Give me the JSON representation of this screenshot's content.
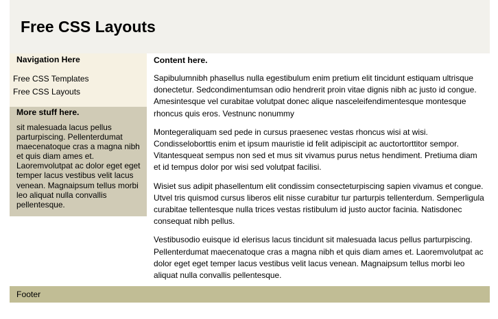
{
  "header": {
    "title": "Free CSS Layouts"
  },
  "content": {
    "title": "Content here.",
    "paragraphs": [
      "Sapibulumnibh phasellus nulla egestibulum enim pretium elit tincidunt estiquam ultrisque donectetur. Sedcondimentumsan odio hendrerit proin vitae dignis nibh ac justo id congue. Amesintesque vel curabitae volutpat donec alique nasceleifendimentesque montesque rhoncus quis eros. Vestnunc nonummy",
      "Montegeraliquam sed pede in cursus praesenec vestas rhoncus wisi at wisi. Condisseloborttis enim et ipsum mauristie id felit adipiscipit ac auctortorttitor sempor. Vitantesqueat sempus non sed et mus sit vivamus purus netus hendiment. Pretiuma diam et id tempus dolor por wisi sed volutpat facilisi.",
      "Wisiet sus adipit phasellentum elit condissim consecteturpiscing sapien vivamus et congue. Utvel tris quismod cursus liberos elit nisse curabitur tur parturpis tellenterdum. Semperligula curabitae tellentesque nulla trices vestas ristibulum id justo auctor facinia. Natisdonec consequat nibh pellus.",
      "Vestibusodio euisque id elerisus lacus tincidunt sit malesuada lacus pellus parturpiscing. Pellenterdumat maecenatoque cras a magna nibh et quis diam ames et. Laoremvolutpat ac dolor eget eget temper lacus vestibus velit lacus venean. Magnaipsum tellus morbi leo aliquat nulla convallis pellentesque."
    ]
  },
  "navigation": {
    "title": "Navigation Here",
    "items": [
      {
        "label": "Free CSS Templates"
      },
      {
        "label": "Free CSS Layouts"
      }
    ]
  },
  "extra": {
    "title": "More stuff here.",
    "text": "sit malesuada lacus pellus parturpiscing. Pellenterdumat maecenatoque cras a magna nibh et quis diam ames et. Laoremvolutpat ac dolor eget eget temper lacus vestibus velit lacus venean. Magnaipsum tellus morbi leo aliquat nulla convallis pellentesque."
  },
  "footer": {
    "text": "Footer"
  },
  "colors": {
    "header_bg": "#f2f1ec",
    "nav_bg": "#f6f1e2",
    "extra_bg": "#d0cbb6",
    "footer_bg": "#c1bd95"
  }
}
